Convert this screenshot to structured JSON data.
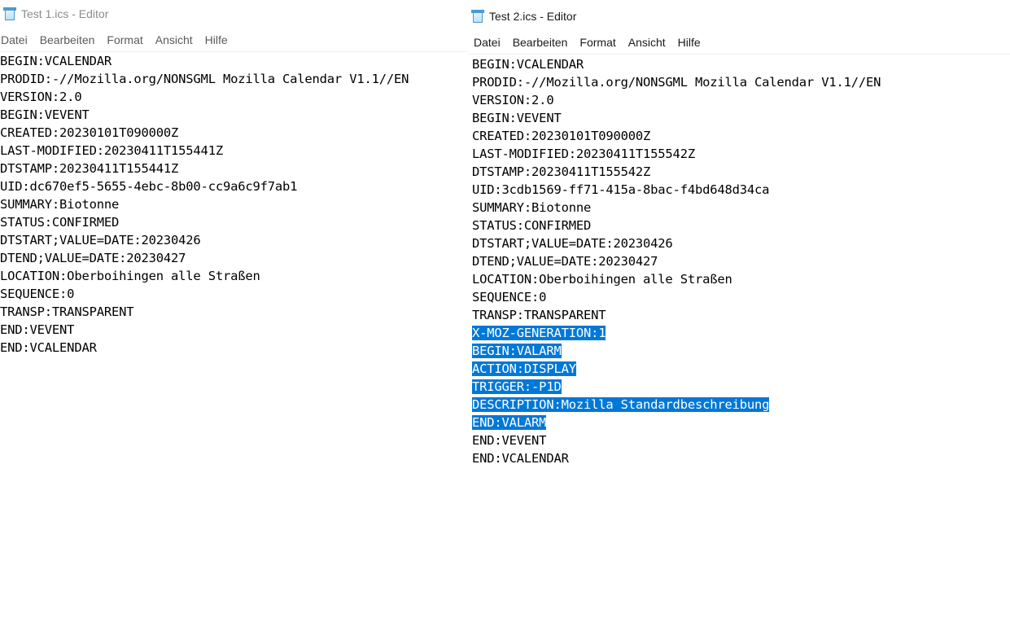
{
  "window1": {
    "title": "Test 1.ics - Editor",
    "menu": [
      "Datei",
      "Bearbeiten",
      "Format",
      "Ansicht",
      "Hilfe"
    ],
    "lines": [
      "BEGIN:VCALENDAR",
      "PRODID:-//Mozilla.org/NONSGML Mozilla Calendar V1.1//EN",
      "VERSION:2.0",
      "BEGIN:VEVENT",
      "CREATED:20230101T090000Z",
      "LAST-MODIFIED:20230411T155441Z",
      "DTSTAMP:20230411T155441Z",
      "UID:dc670ef5-5655-4ebc-8b00-cc9a6c9f7ab1",
      "SUMMARY:Biotonne",
      "STATUS:CONFIRMED",
      "DTSTART;VALUE=DATE:20230426",
      "DTEND;VALUE=DATE:20230427",
      "LOCATION:Oberboihingen alle Straßen",
      "SEQUENCE:0",
      "TRANSP:TRANSPARENT",
      "END:VEVENT",
      "END:VCALENDAR"
    ]
  },
  "window2": {
    "title": "Test 2.ics - Editor",
    "menu": [
      "Datei",
      "Bearbeiten",
      "Format",
      "Ansicht",
      "Hilfe"
    ],
    "lines": [
      "BEGIN:VCALENDAR",
      "PRODID:-//Mozilla.org/NONSGML Mozilla Calendar V1.1//EN",
      "VERSION:2.0",
      "BEGIN:VEVENT",
      "CREATED:20230101T090000Z",
      "LAST-MODIFIED:20230411T155542Z",
      "DTSTAMP:20230411T155542Z",
      "UID:3cdb1569-ff71-415a-8bac-f4bd648d34ca",
      "SUMMARY:Biotonne",
      "STATUS:CONFIRMED",
      "DTSTART;VALUE=DATE:20230426",
      "DTEND;VALUE=DATE:20230427",
      "LOCATION:Oberboihingen alle Straßen",
      "SEQUENCE:0",
      "TRANSP:TRANSPARENT",
      "X-MOZ-GENERATION:1",
      "BEGIN:VALARM",
      "ACTION:DISPLAY",
      "TRIGGER:-P1D",
      "DESCRIPTION:Mozilla Standardbeschreibung",
      "END:VALARM",
      "END:VEVENT",
      "END:VCALENDAR"
    ],
    "selected_lines": [
      15,
      16,
      17,
      18,
      19,
      20
    ]
  },
  "colors": {
    "selection": "#0078d7",
    "inactive_title": "#8c8c8c",
    "icon_accent": "#4a9bd1"
  }
}
